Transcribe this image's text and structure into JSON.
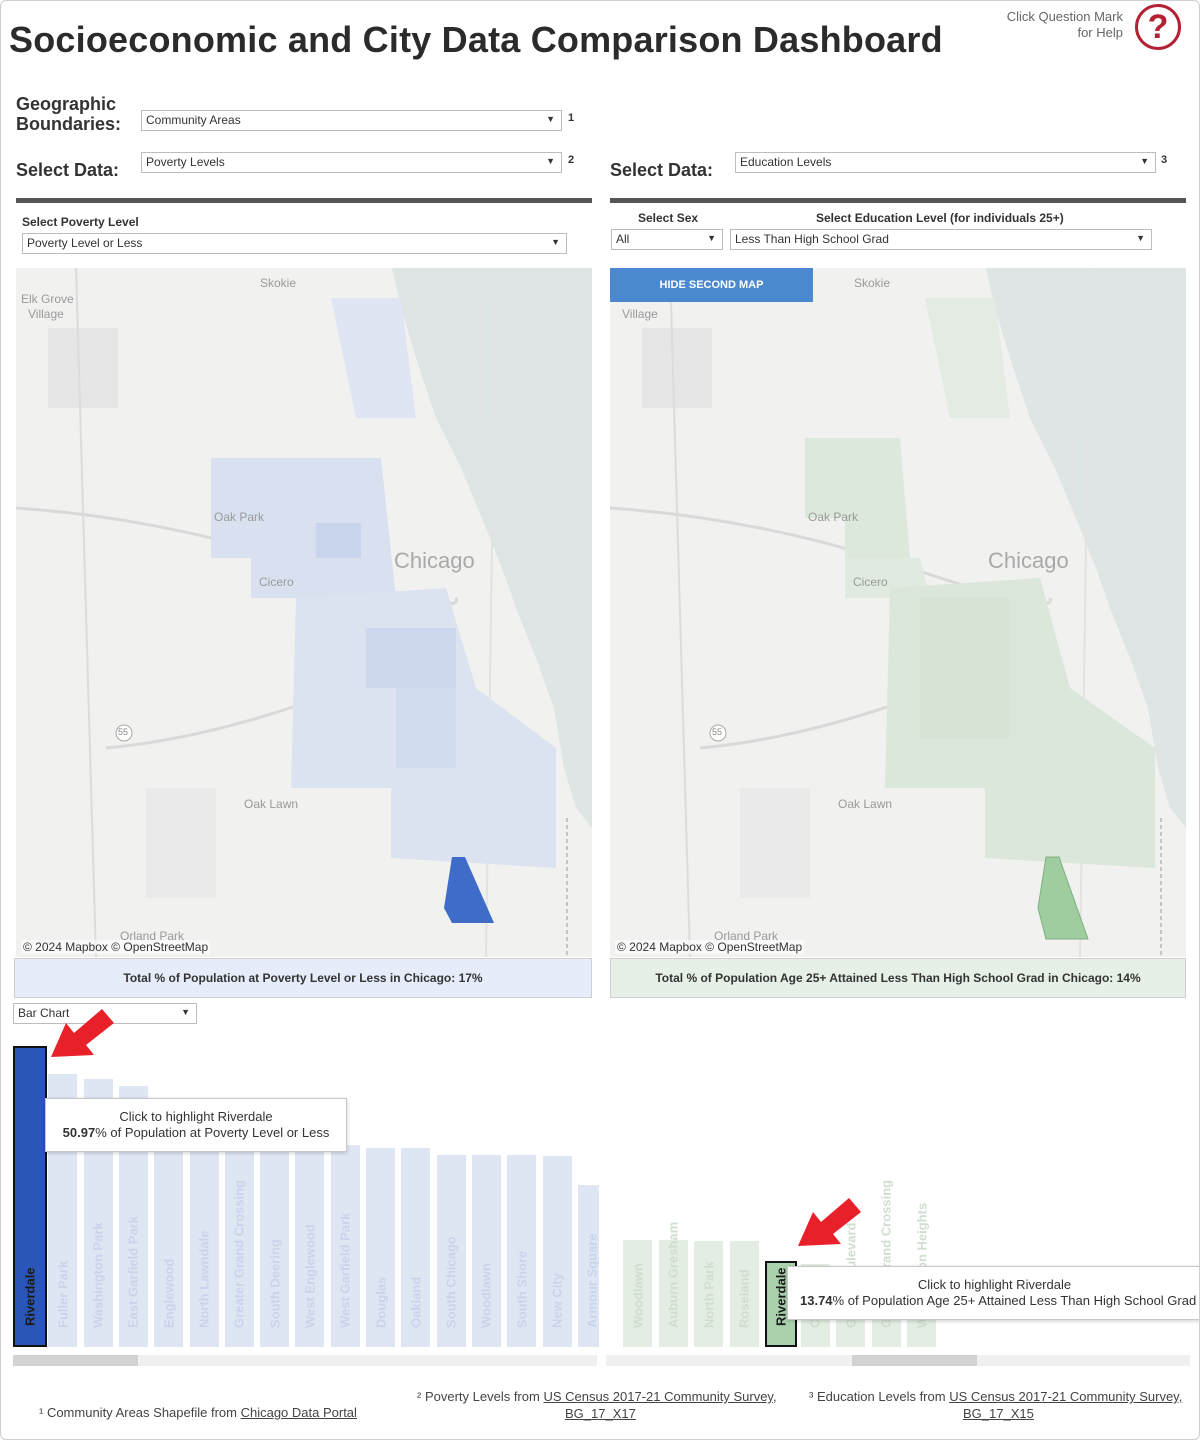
{
  "header": {
    "title": "Socioeconomic and City Data Comparison Dashboard",
    "help_line1": "Click Question Mark",
    "help_line2": "for Help",
    "help_icon_glyph": "?"
  },
  "controls": {
    "geo_label_line1": "Geographic",
    "geo_label_line2": "Boundaries:",
    "geo_value": "Community Areas",
    "geo_sup": "1",
    "select_data_label": "Select Data:",
    "left_data_value": "Poverty Levels",
    "left_sup": "2",
    "right_data_value": "Education Levels",
    "right_sup": "3"
  },
  "left": {
    "filter_label": "Select Poverty Level",
    "filter_value": "Poverty Level or Less",
    "map_labels": [
      "Elk Grove",
      "Village",
      "Skokie",
      "Oak Park",
      "Chicago",
      "Cicero",
      "Oak Lawn",
      "Orland Park",
      "55"
    ],
    "attribution": "© 2024 Mapbox  © OpenStreetMap",
    "summary": "Total % of Population at Poverty Level or Less in Chicago: 17%",
    "chart_type_value": "Bar Chart",
    "tooltip_line1": "Click to highlight Riverdale",
    "tooltip_value": "50.97",
    "tooltip_rest": "% of Population at Poverty Level or Less"
  },
  "right": {
    "sex_label": "Select Sex",
    "sex_value": "All",
    "edu_label": "Select Education Level (for individuals 25+)",
    "edu_value": "Less Than High School Grad",
    "hide_button": "HIDE SECOND MAP",
    "map_labels": [
      "Village",
      "Skokie",
      "Oak Park",
      "Chicago",
      "Cicero",
      "Oak Lawn",
      "Orland Park",
      "55"
    ],
    "attribution": "© 2024 Mapbox  © OpenStreetMap",
    "summary": "Total % of Population Age 25+ Attained Less Than High School Grad in Chicago: 14%",
    "tooltip_line1": "Click to highlight Riverdale",
    "tooltip_value": "13.74",
    "tooltip_rest": "% of Population Age 25+ Attained Less Than High School Grad"
  },
  "chart_data": [
    {
      "type": "bar",
      "title": "",
      "categories": [
        "Riverdale",
        "Fuller Park",
        "Washington Park",
        "East Garfield Park",
        "Englewood",
        "North Lawndale",
        "Greater Grand Crossing",
        "South Deering",
        "West Englewood",
        "West Garfield Park",
        "Douglas",
        "Oakland",
        "South Chicago",
        "Woodlawn",
        "South Shore",
        "New City",
        "Armour Square"
      ],
      "values": [
        50.97,
        46.5,
        45.8,
        44.6,
        37.0,
        36.5,
        36.3,
        36.2,
        36.2,
        35.3,
        34.8,
        34.7,
        33.7,
        33.7,
        33.6,
        33.5,
        28.9
      ],
      "highlight": "Riverdale",
      "colors": {
        "highlight": "#2a56b8",
        "base": "#dfe6f3",
        "label": "#c9d4ea"
      }
    },
    {
      "type": "bar",
      "title": "",
      "categories": [
        "Woodlawn",
        "Auburn Gresham",
        "North Park",
        "Roseland",
        "Riverdale",
        "Chatham",
        "Grand Boulevard",
        "Greater Grand Crossing",
        "Washington Heights"
      ],
      "values": [
        19.5,
        19.5,
        19.4,
        19.3,
        13.74,
        12.8,
        12.4,
        11.6,
        9.2
      ],
      "highlight": "Riverdale",
      "colors": {
        "highlight": "#a9d2ac",
        "base": "#e3ede3",
        "label": "#cfdecf"
      }
    }
  ],
  "footnotes": {
    "fn1_prefix": "¹ Community Areas Shapefile from ",
    "fn1_link": "Chicago Data Portal",
    "fn2_prefix": "² Poverty Levels from ",
    "fn2_link1": "US Census 2017-21 Community Survey,",
    "fn2_link2": "BG_17_X17",
    "fn3_prefix": "³ Education Levels from ",
    "fn3_link1": "US Census 2017-21 Community Survey,",
    "fn3_link2": "BG_17_X15"
  },
  "theme": {
    "accent_blue": "#4a89d0",
    "poverty_blue": "#3f6cc8",
    "education_green": "#9fcd9f",
    "help_red": "#b22234",
    "arrow_red": "#e8202a"
  }
}
